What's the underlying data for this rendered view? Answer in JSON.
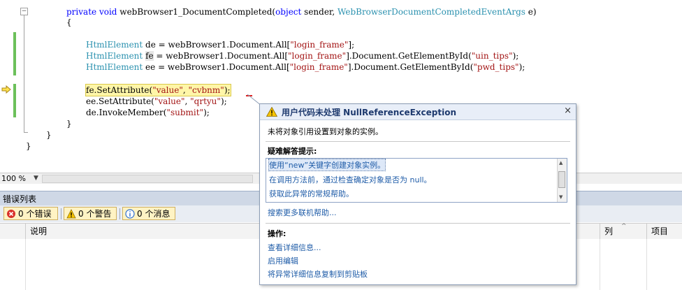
{
  "code": {
    "line1": {
      "kw1": "private",
      "kw2": "void",
      "rest1": " webBrowser1_DocumentCompleted(",
      "kw3": "object",
      "rest2": " sender, ",
      "ty": "WebBrowserDocumentCompletedEventArgs",
      "rest3": " e)"
    },
    "line2": "{",
    "line3": {
      "ty": "HtmlElement",
      "rest1": " de = webBrowser1.Document.All[",
      "st": "\"login_frame\"",
      "rest2": "];"
    },
    "line4": {
      "ty": "HtmlElement",
      "pre": " ",
      "hl": "fe",
      "rest1": " = webBrowser1.Document.All[",
      "st1": "\"login_frame\"",
      "rest2": "].Document.GetElementById(",
      "st2": "\"uin_tips\"",
      "rest3": ");"
    },
    "line5": {
      "ty": "HtmlElement",
      "rest1": " ee = webBrowser1.Document.All[",
      "st1": "\"login_frame\"",
      "rest2": "].Document.GetElementById(",
      "st2": "\"pwd_tips\"",
      "rest3": ");"
    },
    "line6": {
      "a": "fe.SetAttribute(",
      "st1": "\"value\"",
      "b": ", ",
      "st2": "\"cvbnm\"",
      "c": ");"
    },
    "line7": {
      "a": "ee.SetAttribute(",
      "st1": "\"value\"",
      "b": ", ",
      "st2": "\"qrtyu\"",
      "c": ");"
    },
    "line8": {
      "a": "de.InvokeMember(",
      "st": "\"submit\"",
      "b": ");"
    },
    "line9": "}",
    "line10": "}",
    "line11": "}"
  },
  "editor": {
    "zoom": "100 %",
    "zoom_icon": "dropdown-arrow"
  },
  "error_panel": {
    "title": "错误列表",
    "errors": "0 个错误",
    "warnings": "0 个警告",
    "messages": "0 个消息",
    "columns": {
      "desc": "说明",
      "col": "列",
      "project": "项目"
    }
  },
  "exception": {
    "title": "用户代码未处理 NullReferenceException",
    "close": "×",
    "message": "未将对象引用设置到对象的实例。",
    "hints_label": "疑难解答提示:",
    "hints": [
      "使用“new”关键字创建对象实例。",
      "在调用方法前，通过检查确定对象是否为 null。",
      "获取此异常的常规帮助。"
    ],
    "search_more": "搜索更多联机帮助...",
    "actions_label": "操作:",
    "actions": [
      "查看详细信息...",
      "启用编辑",
      "将异常详细信息复制到剪贴板"
    ]
  },
  "colors": {
    "keyword": "#0000ff",
    "type": "#2b91af",
    "string": "#a31515",
    "change_marker": "#6cc05a",
    "link": "#1f5ca8"
  }
}
